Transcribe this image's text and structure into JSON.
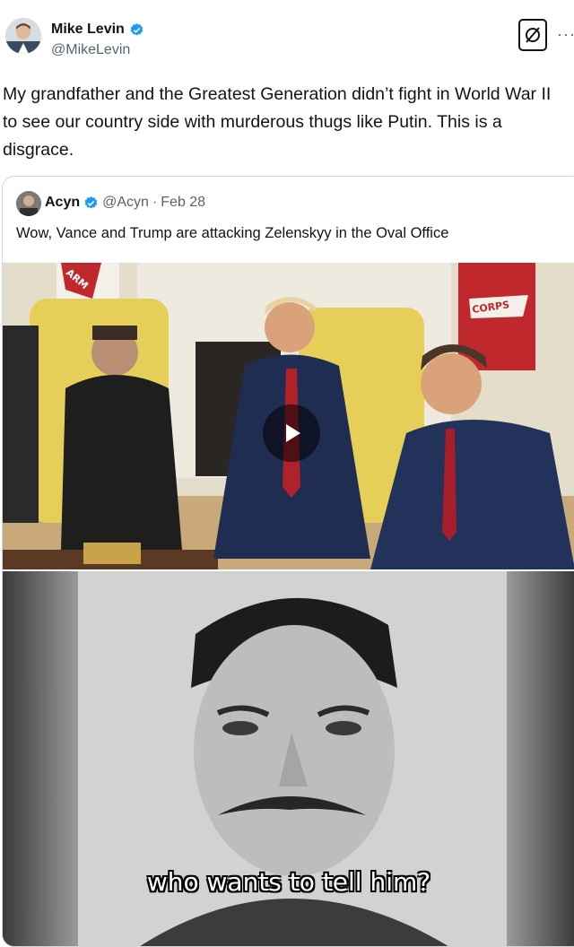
{
  "author": {
    "name": "Mike Levin",
    "handle": "@MikeLevin"
  },
  "post": {
    "text": "My grandfather and the Greatest Generation didn’t fight in World War II to see our country side with murderous thugs like Putin. This is a disgrace."
  },
  "actions": {
    "more": "···"
  },
  "quote": {
    "name": "Acyn",
    "handle": "@Acyn",
    "date": "Feb 28",
    "separator": "·",
    "text": "Wow, Vance and Trump are attacking Zelenskyy in the Oval Office"
  },
  "media": {
    "caption": "who wants to tell him?",
    "flag_left": "ARM",
    "flag_right": "CORPS"
  },
  "colors": {
    "verified": "#1d9bf0",
    "secondary_text": "#536471",
    "border": "#cfd9de"
  },
  "icons": [
    "verified-badge-icon",
    "grok-icon",
    "more-icon",
    "play-icon"
  ]
}
